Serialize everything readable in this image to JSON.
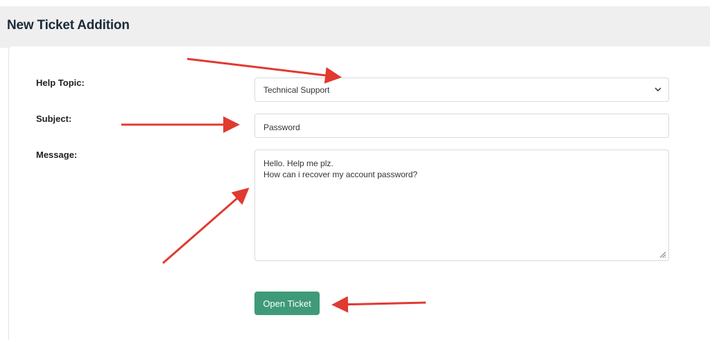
{
  "page": {
    "title": "New Ticket Addition"
  },
  "form": {
    "help_topic_label": "Help Topic:",
    "help_topic_value": "Technical Support",
    "subject_label": "Subject:",
    "subject_value": "Password",
    "message_label": "Message:",
    "message_lines": [
      "Hello. Help me plz.",
      "How can i recover my account password?"
    ],
    "submit_label": "Open Ticket"
  },
  "colors": {
    "arrow": "#e03a31",
    "button": "#3f9a7a",
    "header_band": "#efefef"
  },
  "icons": {
    "select_chevron": "chevron-down-icon",
    "textarea_grip": "resize-grip-icon",
    "annotation": "arrow-icon"
  }
}
